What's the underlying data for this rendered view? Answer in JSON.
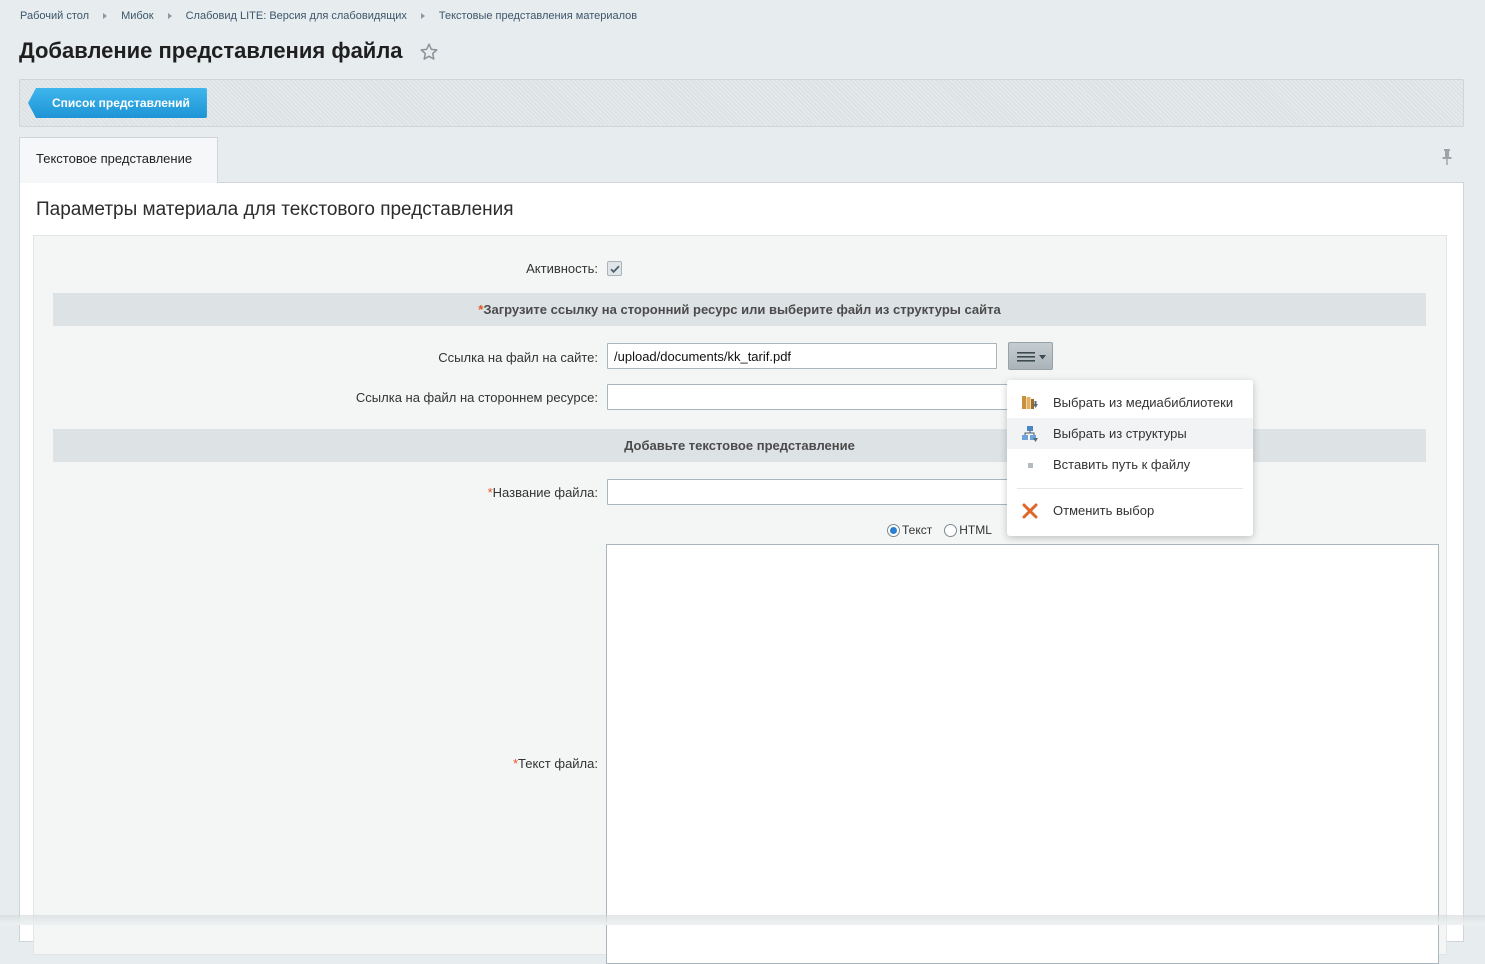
{
  "breadcrumbs": [
    "Рабочий стол",
    "Мибок",
    "Слабовид LITE: Версия для слабовидящих",
    "Текстовые представления материалов"
  ],
  "page": {
    "title": "Добавление представления файла"
  },
  "toolbar": {
    "list_button": "Список представлений"
  },
  "tabs": [
    {
      "label": "Текстовое представление"
    }
  ],
  "section": {
    "title": "Параметры материала для текстового представления"
  },
  "form": {
    "active_label": "Активность:",
    "active_checked": true,
    "group1": {
      "asterisk": "*",
      "text": "Загрузите ссылку на сторонний ресурс или выберите файл из структуры сайта"
    },
    "site_link_label": "Ссылка на файл на сайте:",
    "site_link_value": "/upload/documents/kk_tarif.pdf",
    "external_link_label": "Ссылка на файл на стороннем ресурсе:",
    "external_link_value": "",
    "group2": {
      "text": "Добавьте текстовое представление"
    },
    "name_asterisk": "*",
    "name_label": "Название файла:",
    "name_value": "",
    "format_options": [
      {
        "label": "Текст",
        "checked": true
      },
      {
        "label": "HTML",
        "checked": false
      }
    ],
    "text_asterisk": "*",
    "text_label": "Текст файла:"
  },
  "popup_menu": {
    "items": [
      {
        "label": "Выбрать из медиабиблиотеки",
        "icon": "media-library-icon"
      },
      {
        "label": "Выбрать из структуры",
        "icon": "structure-icon",
        "hover": true
      },
      {
        "label": "Вставить путь к файлу",
        "icon": "dot-icon"
      },
      {
        "label": "Отменить выбор",
        "icon": "cancel-x-icon"
      }
    ]
  },
  "colors": {
    "accent": "#2a9fe0",
    "required": "#e65522",
    "background": "#e7ecee"
  },
  "icons": {
    "star": "star-icon",
    "pin": "pin-icon",
    "menu": "hamburger-icon",
    "dropdown": "chevron-down-icon"
  }
}
